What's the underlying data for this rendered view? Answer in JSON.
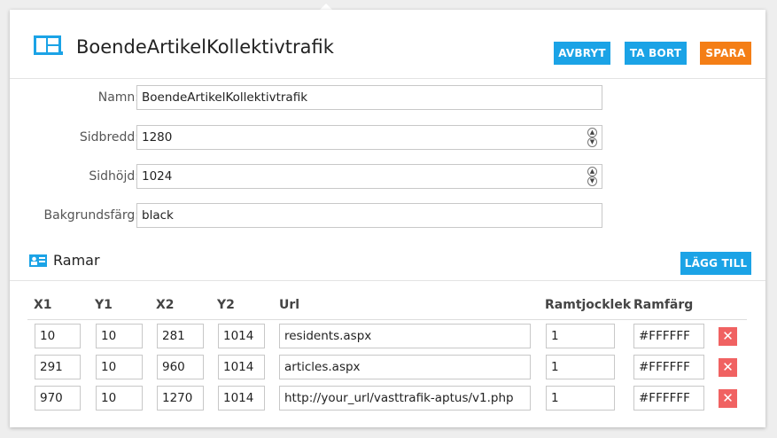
{
  "header": {
    "title": "BoendeArtikelKollektivtrafik",
    "cancel_label": "AVBRYT",
    "delete_label": "TA BORT",
    "save_label": "SPARA"
  },
  "form": {
    "name_label": "Namn:",
    "name_value": "BoendeArtikelKollektivtrafik",
    "width_label": "Sidbredd:",
    "width_value": "1280",
    "height_label": "Sidhöjd:",
    "height_value": "1024",
    "bg_label": "Bakgrundsfärg:",
    "bg_value": "black"
  },
  "frames": {
    "title": "Ramar",
    "add_label": "LÄGG TILL",
    "columns": [
      "X1",
      "Y1",
      "X2",
      "Y2",
      "Url",
      "Ramtjocklek",
      "Ramfärg"
    ],
    "rows": [
      {
        "x1": "10",
        "y1": "10",
        "x2": "281",
        "y2": "1014",
        "url": "residents.aspx",
        "thickness": "1",
        "color": "#FFFFFF",
        "delete": "✕"
      },
      {
        "x1": "291",
        "y1": "10",
        "x2": "960",
        "y2": "1014",
        "url": "articles.aspx",
        "thickness": "1",
        "color": "#FFFFFF",
        "delete": "✕"
      },
      {
        "x1": "970",
        "y1": "10",
        "x2": "1270",
        "y2": "1014",
        "url": "http://your_url/vasttrafik-aptus/v1.php",
        "thickness": "1",
        "color": "#FFFFFF",
        "delete": "✕"
      }
    ]
  },
  "icons": {
    "page": "layout-icon",
    "section": "id-card-icon",
    "spinner_up": "▲",
    "spinner_down": "▼"
  },
  "colors": {
    "primary": "#1ba3e6",
    "save": "#f47e16",
    "delete": "#f06262"
  }
}
